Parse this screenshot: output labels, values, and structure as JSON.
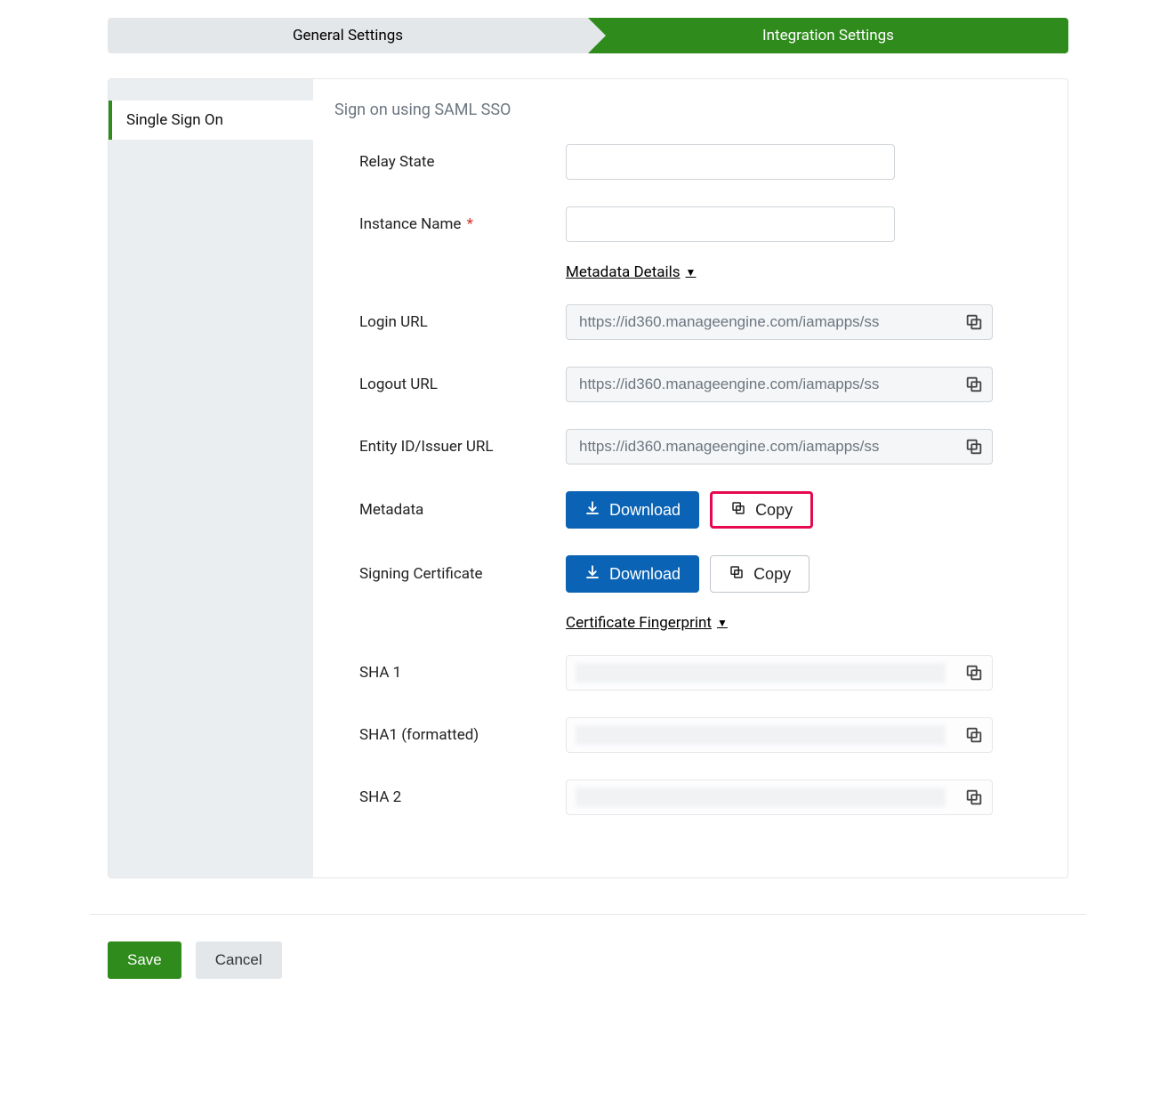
{
  "stepper": {
    "general": "General Settings",
    "integration": "Integration Settings"
  },
  "sidebar": {
    "item": "Single Sign On"
  },
  "subtitle": "Sign on using SAML SSO",
  "labels": {
    "relay_state": "Relay State",
    "instance_name": "Instance Name",
    "login_url": "Login URL",
    "logout_url": "Logout URL",
    "entity_url": "Entity ID/Issuer URL",
    "metadata": "Metadata",
    "signing_cert": "Signing Certificate",
    "sha1": "SHA 1",
    "sha1_fmt": "SHA1 (formatted)",
    "sha2": "SHA 2"
  },
  "toggles": {
    "metadata_details": "Metadata Details",
    "cert_fingerprint": "Certificate Fingerprint"
  },
  "values": {
    "login_url": "https://id360.manageengine.com/iamapps/ss",
    "logout_url": "https://id360.manageengine.com/iamapps/ss",
    "entity_url": "https://id360.manageengine.com/iamapps/ss"
  },
  "buttons": {
    "download": "Download",
    "copy": "Copy",
    "save": "Save",
    "cancel": "Cancel"
  },
  "required_mark": "*"
}
